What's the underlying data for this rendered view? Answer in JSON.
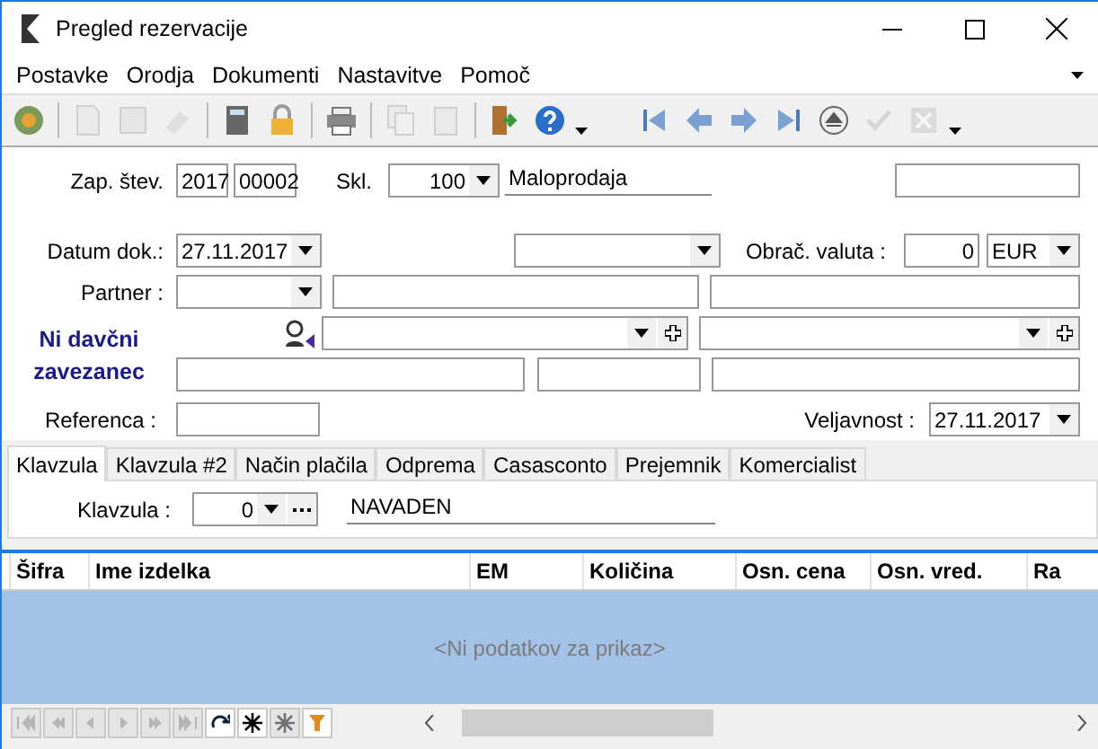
{
  "window": {
    "title": "Pregled rezervacije"
  },
  "menu": [
    {
      "label": "Postavke"
    },
    {
      "label": "Orodja"
    },
    {
      "label": "Dokumenti"
    },
    {
      "label": "Nastavitve"
    },
    {
      "label": "Pomoč"
    }
  ],
  "toolbar": [
    {
      "kind": "refresh",
      "disabled": false
    },
    {
      "kind": "sep"
    },
    {
      "kind": "new",
      "disabled": true
    },
    {
      "kind": "save",
      "disabled": true
    },
    {
      "kind": "erase",
      "disabled": true
    },
    {
      "kind": "sep"
    },
    {
      "kind": "calculator",
      "disabled": false
    },
    {
      "kind": "lock",
      "disabled": false
    },
    {
      "kind": "sep"
    },
    {
      "kind": "print",
      "disabled": false
    },
    {
      "kind": "sep"
    },
    {
      "kind": "copy",
      "disabled": true
    },
    {
      "kind": "paste",
      "disabled": true
    },
    {
      "kind": "sep"
    },
    {
      "kind": "exit",
      "disabled": false
    },
    {
      "kind": "help",
      "disabled": false
    },
    {
      "kind": "more"
    },
    {
      "kind": "gap"
    },
    {
      "kind": "first",
      "disabled": false
    },
    {
      "kind": "prev",
      "disabled": false
    },
    {
      "kind": "next",
      "disabled": false
    },
    {
      "kind": "last",
      "disabled": false
    },
    {
      "kind": "eject",
      "disabled": false
    },
    {
      "kind": "check",
      "disabled": true
    },
    {
      "kind": "cancel",
      "disabled": true
    },
    {
      "kind": "more"
    }
  ],
  "form": {
    "number": {
      "label": "Zap. štev.",
      "year": "2017",
      "value": "00002"
    },
    "warehouse": {
      "label": "Skl.",
      "value": "100",
      "name": "Maloprodaja"
    },
    "doc_date": {
      "label": "Datum dok.:",
      "value": "27.11.2017"
    },
    "currency": {
      "label": "Obrač. valuta :",
      "rate": "0",
      "value": "EUR"
    },
    "partner": {
      "label": "Partner :"
    },
    "tax_note": "Ni davčni zavezanec",
    "reference": {
      "label": "Referenca :"
    },
    "validity": {
      "label": "Veljavnost :",
      "value": "27.11.2017"
    }
  },
  "tabs": [
    {
      "label": "Klavzula",
      "selected": true
    },
    {
      "label": "Klavzula #2",
      "selected": false
    },
    {
      "label": "Način plačila",
      "selected": false
    },
    {
      "label": "Odprema",
      "selected": false
    },
    {
      "label": "Casasconto",
      "selected": false
    },
    {
      "label": "Prejemnik",
      "selected": false
    },
    {
      "label": "Komercialist",
      "selected": false
    }
  ],
  "clause": {
    "label": "Klavzula :",
    "value": "0",
    "name": "NAVADEN"
  },
  "table": {
    "columns": [
      "Šifra",
      "Ime izdelka",
      "EM",
      "Količina",
      "Osn. cena",
      "Osn. vred.",
      "Ra"
    ],
    "empty_message": "<Ni podatkov za prikaz>"
  },
  "navigator": [
    {
      "kind": "first",
      "disabled": true
    },
    {
      "kind": "prevpage",
      "disabled": true
    },
    {
      "kind": "prev",
      "disabled": true
    },
    {
      "kind": "next",
      "disabled": true
    },
    {
      "kind": "nextpage",
      "disabled": true
    },
    {
      "kind": "last",
      "disabled": true
    },
    {
      "kind": "refresh",
      "disabled": false
    },
    {
      "kind": "star",
      "disabled": false
    },
    {
      "kind": "star",
      "disabled": true
    },
    {
      "kind": "filter",
      "disabled": false
    }
  ]
}
